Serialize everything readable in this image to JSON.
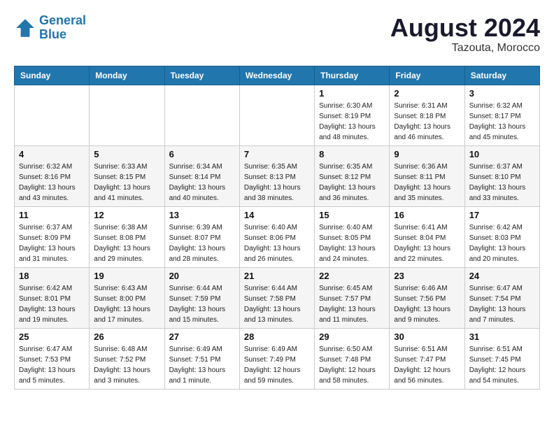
{
  "logo": {
    "text1": "General",
    "text2": "Blue"
  },
  "title": {
    "monthYear": "August 2024",
    "location": "Tazouta, Morocco"
  },
  "headers": [
    "Sunday",
    "Monday",
    "Tuesday",
    "Wednesday",
    "Thursday",
    "Friday",
    "Saturday"
  ],
  "weeks": [
    [
      {
        "day": "",
        "info": ""
      },
      {
        "day": "",
        "info": ""
      },
      {
        "day": "",
        "info": ""
      },
      {
        "day": "",
        "info": ""
      },
      {
        "day": "1",
        "info": "Sunrise: 6:30 AM\nSunset: 8:19 PM\nDaylight: 13 hours\nand 48 minutes."
      },
      {
        "day": "2",
        "info": "Sunrise: 6:31 AM\nSunset: 8:18 PM\nDaylight: 13 hours\nand 46 minutes."
      },
      {
        "day": "3",
        "info": "Sunrise: 6:32 AM\nSunset: 8:17 PM\nDaylight: 13 hours\nand 45 minutes."
      }
    ],
    [
      {
        "day": "4",
        "info": "Sunrise: 6:32 AM\nSunset: 8:16 PM\nDaylight: 13 hours\nand 43 minutes."
      },
      {
        "day": "5",
        "info": "Sunrise: 6:33 AM\nSunset: 8:15 PM\nDaylight: 13 hours\nand 41 minutes."
      },
      {
        "day": "6",
        "info": "Sunrise: 6:34 AM\nSunset: 8:14 PM\nDaylight: 13 hours\nand 40 minutes."
      },
      {
        "day": "7",
        "info": "Sunrise: 6:35 AM\nSunset: 8:13 PM\nDaylight: 13 hours\nand 38 minutes."
      },
      {
        "day": "8",
        "info": "Sunrise: 6:35 AM\nSunset: 8:12 PM\nDaylight: 13 hours\nand 36 minutes."
      },
      {
        "day": "9",
        "info": "Sunrise: 6:36 AM\nSunset: 8:11 PM\nDaylight: 13 hours\nand 35 minutes."
      },
      {
        "day": "10",
        "info": "Sunrise: 6:37 AM\nSunset: 8:10 PM\nDaylight: 13 hours\nand 33 minutes."
      }
    ],
    [
      {
        "day": "11",
        "info": "Sunrise: 6:37 AM\nSunset: 8:09 PM\nDaylight: 13 hours\nand 31 minutes."
      },
      {
        "day": "12",
        "info": "Sunrise: 6:38 AM\nSunset: 8:08 PM\nDaylight: 13 hours\nand 29 minutes."
      },
      {
        "day": "13",
        "info": "Sunrise: 6:39 AM\nSunset: 8:07 PM\nDaylight: 13 hours\nand 28 minutes."
      },
      {
        "day": "14",
        "info": "Sunrise: 6:40 AM\nSunset: 8:06 PM\nDaylight: 13 hours\nand 26 minutes."
      },
      {
        "day": "15",
        "info": "Sunrise: 6:40 AM\nSunset: 8:05 PM\nDaylight: 13 hours\nand 24 minutes."
      },
      {
        "day": "16",
        "info": "Sunrise: 6:41 AM\nSunset: 8:04 PM\nDaylight: 13 hours\nand 22 minutes."
      },
      {
        "day": "17",
        "info": "Sunrise: 6:42 AM\nSunset: 8:03 PM\nDaylight: 13 hours\nand 20 minutes."
      }
    ],
    [
      {
        "day": "18",
        "info": "Sunrise: 6:42 AM\nSunset: 8:01 PM\nDaylight: 13 hours\nand 19 minutes."
      },
      {
        "day": "19",
        "info": "Sunrise: 6:43 AM\nSunset: 8:00 PM\nDaylight: 13 hours\nand 17 minutes."
      },
      {
        "day": "20",
        "info": "Sunrise: 6:44 AM\nSunset: 7:59 PM\nDaylight: 13 hours\nand 15 minutes."
      },
      {
        "day": "21",
        "info": "Sunrise: 6:44 AM\nSunset: 7:58 PM\nDaylight: 13 hours\nand 13 minutes."
      },
      {
        "day": "22",
        "info": "Sunrise: 6:45 AM\nSunset: 7:57 PM\nDaylight: 13 hours\nand 11 minutes."
      },
      {
        "day": "23",
        "info": "Sunrise: 6:46 AM\nSunset: 7:56 PM\nDaylight: 13 hours\nand 9 minutes."
      },
      {
        "day": "24",
        "info": "Sunrise: 6:47 AM\nSunset: 7:54 PM\nDaylight: 13 hours\nand 7 minutes."
      }
    ],
    [
      {
        "day": "25",
        "info": "Sunrise: 6:47 AM\nSunset: 7:53 PM\nDaylight: 13 hours\nand 5 minutes."
      },
      {
        "day": "26",
        "info": "Sunrise: 6:48 AM\nSunset: 7:52 PM\nDaylight: 13 hours\nand 3 minutes."
      },
      {
        "day": "27",
        "info": "Sunrise: 6:49 AM\nSunset: 7:51 PM\nDaylight: 13 hours\nand 1 minute."
      },
      {
        "day": "28",
        "info": "Sunrise: 6:49 AM\nSunset: 7:49 PM\nDaylight: 12 hours\nand 59 minutes."
      },
      {
        "day": "29",
        "info": "Sunrise: 6:50 AM\nSunset: 7:48 PM\nDaylight: 12 hours\nand 58 minutes."
      },
      {
        "day": "30",
        "info": "Sunrise: 6:51 AM\nSunset: 7:47 PM\nDaylight: 12 hours\nand 56 minutes."
      },
      {
        "day": "31",
        "info": "Sunrise: 6:51 AM\nSunset: 7:45 PM\nDaylight: 12 hours\nand 54 minutes."
      }
    ]
  ]
}
